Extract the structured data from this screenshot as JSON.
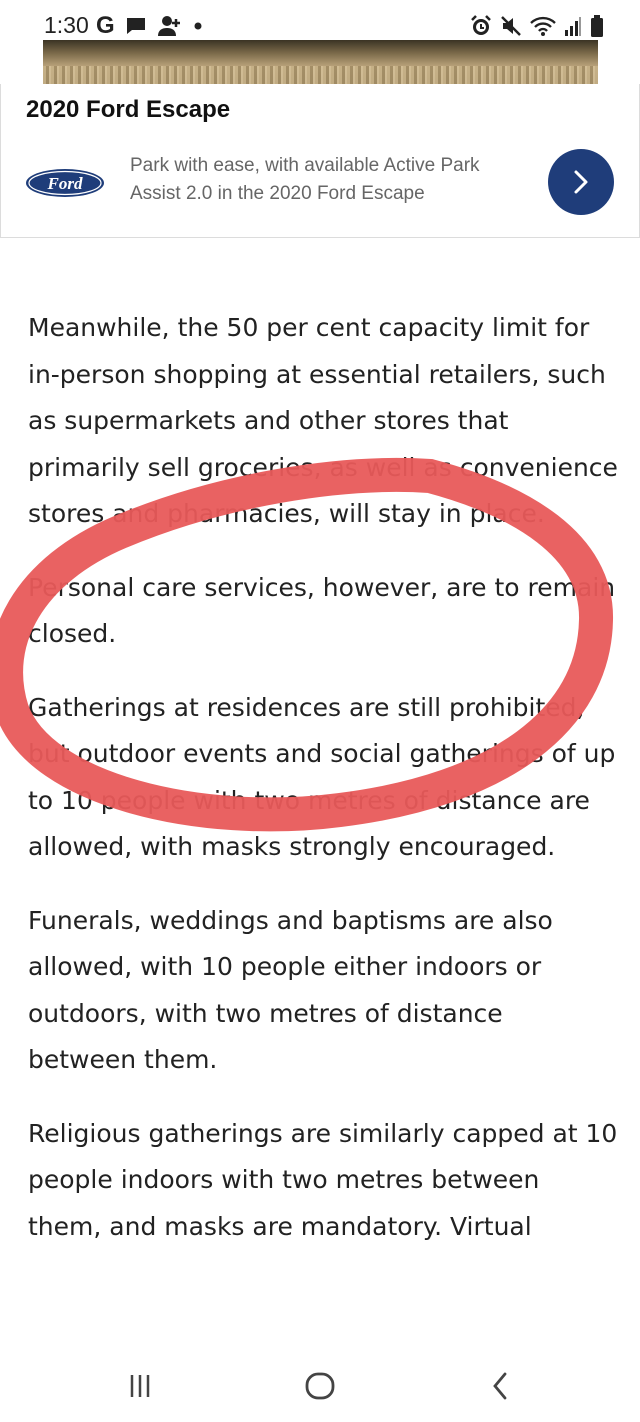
{
  "status_bar": {
    "time": "1:30",
    "left_icons": [
      "google-icon",
      "message-icon",
      "contacts-icon",
      "dot-icon"
    ],
    "right_icons": [
      "alarm-icon",
      "mute-icon",
      "wifi-icon",
      "signal-icon",
      "battery-icon"
    ]
  },
  "ad": {
    "title": "2020 Ford Escape",
    "logo_text": "Ford",
    "text": "Park with ease, with available Active Park Assist 2.0 in the 2020 Ford Escape",
    "cta_icon": "chevron-right-icon",
    "brand_color": "#1f3d7a"
  },
  "article": {
    "paragraphs": [
      "Meanwhile, the 50 per cent capacity limit for in-person shopping at essential retailers, such as supermarkets and other stores that primarily sell groceries, as well as convenience stores and pharmacies, will stay in place.",
      "Personal care services, however, are to remain closed.",
      "Gatherings at residences are still prohibited, but outdoor events and social gatherings of up to 10 people with two metres of distance are allowed, with masks strongly encouraged.",
      "Funerals, weddings and baptisms are also allowed, with 10 people either indoors or outdoors, with two metres of distance between them.",
      "Religious gatherings are similarly capped at 10 people indoors with two metres between them, and masks are mandatory. Virtual"
    ],
    "highlight_color": "#e85a5a"
  },
  "nav_bar": {
    "buttons": [
      "recent-apps-icon",
      "home-icon",
      "back-icon"
    ]
  }
}
